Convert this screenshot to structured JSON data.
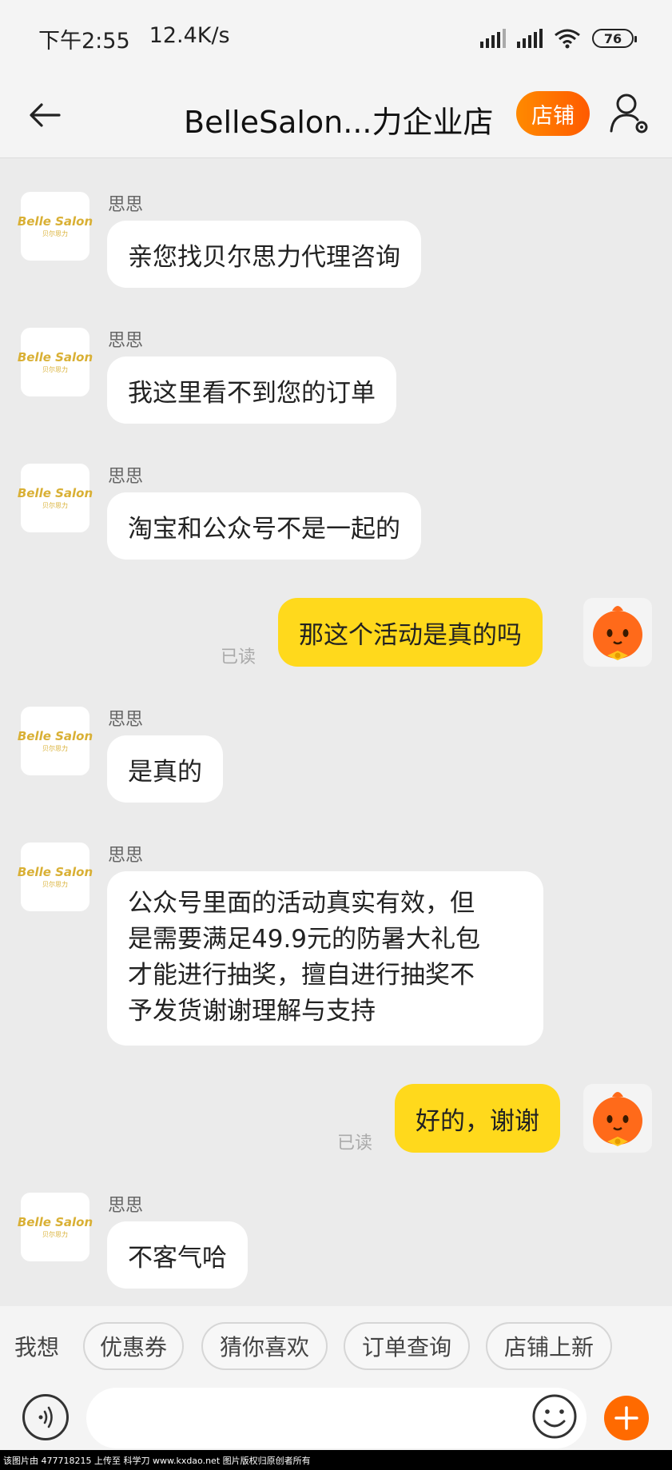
{
  "status_bar": {
    "time": "下午2:55",
    "speed": "12.4K/s",
    "battery": "76"
  },
  "header": {
    "title": "BelleSalon...力企业店",
    "shop_button": "店铺"
  },
  "shop_avatar": {
    "logo_text": "Belle Salon",
    "logo_sub": "贝尔思力"
  },
  "messages": [
    {
      "from": "shop",
      "sender": "思思",
      "lines": [
        "亲您找贝尔思力代理咨询"
      ]
    },
    {
      "from": "shop",
      "sender": "思思",
      "lines": [
        "我这里看不到您的订单"
      ]
    },
    {
      "from": "shop",
      "sender": "思思",
      "lines": [
        "淘宝和公众号不是一起的"
      ]
    },
    {
      "from": "me",
      "text": "那这个活动是真的吗",
      "status": "已读"
    },
    {
      "from": "shop",
      "sender": "思思",
      "lines": [
        "是真的"
      ]
    },
    {
      "from": "shop",
      "sender": "思思",
      "lines": [
        "公众号里面的活动真实有效，但",
        "是需要满足49.9元的防暑大礼包",
        "才能进行抽奖，擅自进行抽奖不",
        "予发货谢谢理解与支持"
      ]
    },
    {
      "from": "me",
      "text": "好的，谢谢",
      "status": "已读"
    },
    {
      "from": "shop",
      "sender": "思思",
      "lines": [
        "不客气哈"
      ]
    }
  ],
  "quick_bar": {
    "label": "我想",
    "chips": [
      "优惠券",
      "猜你喜欢",
      "订单查询",
      "店铺上新"
    ]
  },
  "input": {
    "value": "",
    "placeholder": ""
  },
  "footer": "该图片由 477718215 上传至 科学刀 www.kxdao.net 图片版权归原创者所有",
  "colors": {
    "accent": "#ff6a00",
    "my_bubble": "#ffd91c",
    "background": "#ebebeb"
  }
}
